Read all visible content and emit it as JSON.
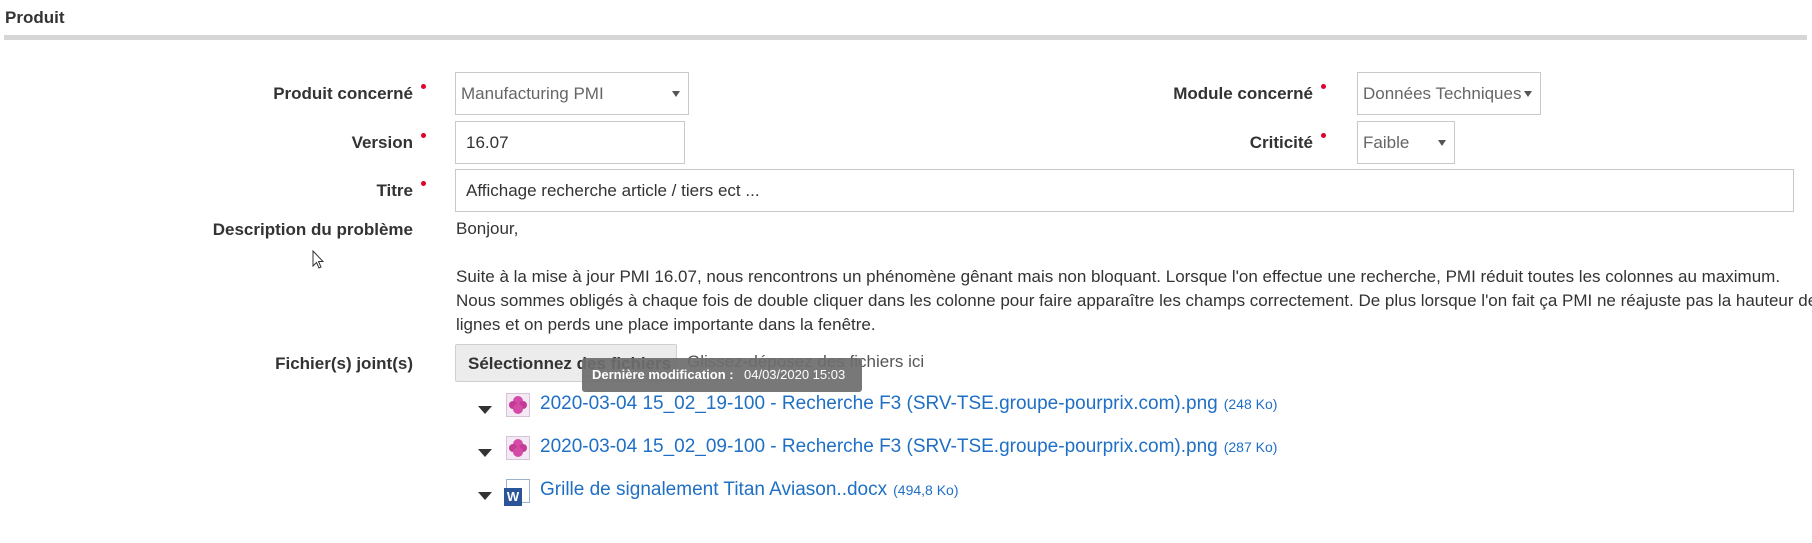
{
  "section": {
    "title": "Produit"
  },
  "form": {
    "produit": {
      "label": "Produit concerné",
      "value": "Manufacturing PMI"
    },
    "module": {
      "label": "Module concerné",
      "value": "Données Techniques"
    },
    "version": {
      "label": "Version",
      "value": "16.07"
    },
    "criticite": {
      "label": "Criticité",
      "value": "Faible"
    },
    "titre": {
      "label": "Titre",
      "value": "Affichage recherche article / tiers ect ..."
    },
    "description": {
      "label": "Description du problème",
      "line1": "Bonjour,",
      "line2": "Suite à la mise à jour PMI 16.07, nous rencontrons un phénomène gênant mais non bloquant. Lorsque l'on effectue une recherche, PMI réduit toutes les colonnes au maximum.",
      "line3": "Nous sommes obligés à chaque fois de double cliquer dans les colonne pour faire apparaître les champs correctement. De plus lorsque l'on fait ça PMI ne réajuste pas la hauteur des",
      "line4": "lignes et on perds une place importante dans la fenêtre."
    },
    "files": {
      "label": "Fichier(s) joint(s)",
      "button_label": "Sélectionnez des fichiers",
      "drop_hint": "Glissez-déposez des fichiers ici",
      "tooltip_label": "Dernière modification :",
      "tooltip_value": "04/03/2020 15:03",
      "items": [
        {
          "name": "2020-03-04 15_02_19-100 - Recherche F3 (SRV-TSE.groupe-pourprix.com).png",
          "size": "(248 Ko)",
          "icon": "image-file-icon"
        },
        {
          "name": "2020-03-04 15_02_09-100 - Recherche F3 (SRV-TSE.groupe-pourprix.com).png",
          "size": "(287 Ko)",
          "icon": "image-file-icon"
        },
        {
          "name": "Grille de signalement Titan Aviason..docx",
          "size": "(494,8 Ko)",
          "icon": "word-file-icon"
        }
      ]
    }
  },
  "colors": {
    "required": "#e0002a",
    "link": "#1f6fc5",
    "rule": "#d6d6d6"
  }
}
